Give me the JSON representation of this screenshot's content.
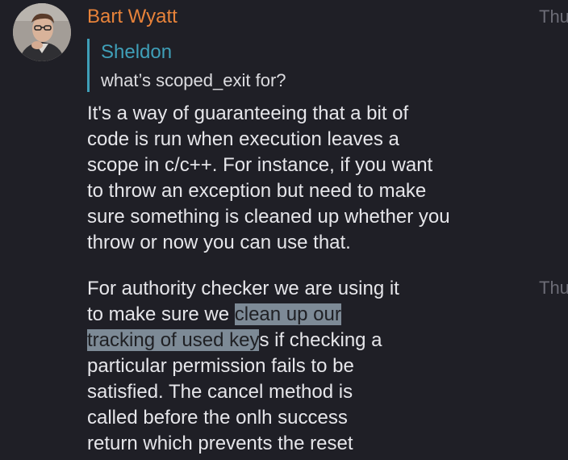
{
  "message": {
    "sender": "Bart Wyatt",
    "timestamps": [
      "Thu",
      "Thu"
    ],
    "quote": {
      "author": "Sheldon",
      "text": "what’s scoped_exit for?"
    },
    "paragraph1": [
      "It's a way of guaranteeing that a bit of",
      "code is run when execution leaves a",
      "scope in c/c++.  For instance, if you want",
      "to throw an exception but need to make",
      "sure something is cleaned up whether you",
      "throw or now you can use that."
    ],
    "paragraph2": {
      "line1": "For authority checker we are using it",
      "line2_before": "to make sure we ",
      "line2_highlight": "clean up our",
      "line3_highlight": "tracking of used key",
      "line3_after": "s if checking a",
      "line4": "particular permission fails to be",
      "line5": "satisfied.  The cancel method is",
      "line6": "called before the onlh success",
      "line7": "return which prevents the reset"
    }
  },
  "colors": {
    "background": "#1f1f26",
    "sender": "#e8833a",
    "quote_accent": "#3f9fb8",
    "text": "#e6e6ea",
    "timestamp": "#6c6c76",
    "selection": "#7d8a96"
  }
}
